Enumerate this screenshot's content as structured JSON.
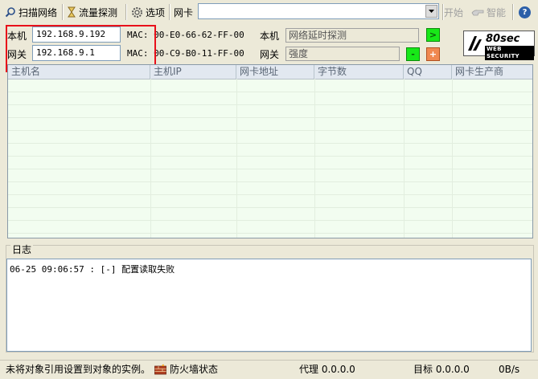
{
  "toolbar": {
    "scan_label": "扫描网络",
    "traffic_label": "流量探测",
    "options_label": "选项",
    "nic_label": "网卡",
    "nic_value": "",
    "start_label": "开始",
    "smart_label": "智能",
    "help_icon": "?"
  },
  "info": {
    "local_label": "本机",
    "local_ip": "192.168.9.192",
    "local_mac": "MAC: 00-E0-66-62-FF-00",
    "gateway_label": "网关",
    "gateway_ip": "192.168.9.1",
    "gateway_mac": "MAC: 00-C9-B0-11-FF-00",
    "right_local_label": "本机",
    "right_local_value": "网络延时探测",
    "right_gateway_label": "网关",
    "right_gateway_value": "强度",
    "go_symbol": ">",
    "minus_symbol": "-",
    "plus_symbol": "+"
  },
  "logo": {
    "main": "80sec",
    "sub": "WEB SECURITY"
  },
  "table": {
    "columns": [
      "主机名",
      "主机IP",
      "网卡地址",
      "字节数",
      "QQ",
      "网卡生产商"
    ],
    "rows": []
  },
  "log": {
    "title": "日志",
    "entries": [
      "06-25 09:06:57 : [-] 配置读取失败"
    ]
  },
  "status": {
    "message": "未将对象引用设置到对象的实例。",
    "firewall_label": "防火墙状态",
    "proxy": "代理 0.0.0.0",
    "target": "目标 0.0.0.0",
    "speed": "0B/s"
  },
  "colors": {
    "highlight_box": "#e8101a",
    "green_button": "#18e818",
    "orange_button": "#f08850",
    "table_bg": "#f2fdf0"
  }
}
